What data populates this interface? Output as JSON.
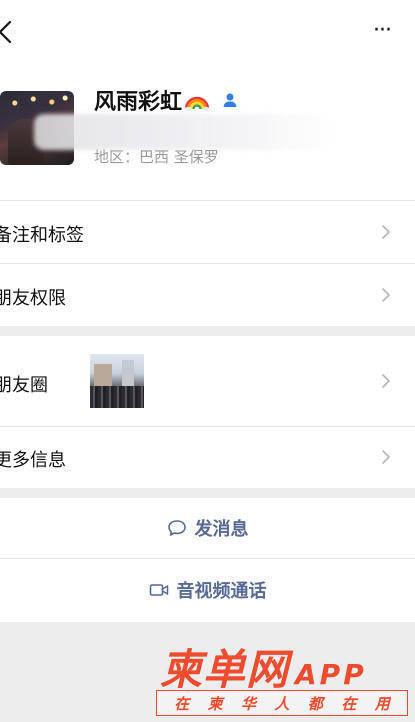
{
  "header": {
    "back_icon": "chevron-left-icon",
    "more_label": "···"
  },
  "profile": {
    "name": "风雨彩虹",
    "name_emoji_icon": "rainbow-icon",
    "gender_icon": "male-icon",
    "gender_color": "#2f7fe6",
    "region": "地区：巴西 圣保罗"
  },
  "rows": {
    "remark_tags": "备注和标签",
    "friend_permissions": "朋友权限",
    "moments": "朋友圈",
    "more_info": "更多信息"
  },
  "actions": {
    "send_message": "发消息",
    "voice_video_call": "音视频通话",
    "accent_color": "#576b95"
  },
  "watermark": {
    "title": "柬单网",
    "app": "APP",
    "slogan_chars": [
      "在",
      "柬",
      "华",
      "人",
      "都",
      "在",
      "用"
    ],
    "color": "#ef4b2e"
  }
}
